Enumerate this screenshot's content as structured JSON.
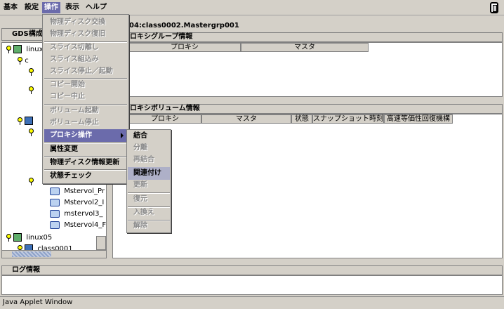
{
  "menubar": {
    "items": [
      "基本",
      "設定",
      "操作",
      "表示",
      "ヘルプ"
    ]
  },
  "left_panel": {
    "title": "GDS構成ツ",
    "tree": {
      "node1": "linux",
      "class_partial": "c",
      "volumes": [
        "Mstervol_Pr",
        "Mstervol2_I",
        "mstervol3_",
        "Mstervol4_F"
      ],
      "node2": "linux05",
      "class2": "class0001"
    }
  },
  "right_panel": {
    "title": "04:class0002.Mastergrp001",
    "group_section": {
      "heading": "ロキシグループ情報",
      "columns": [
        "プロキシ",
        "マスタ"
      ]
    },
    "volume_section": {
      "heading": "ロキシボリューム情報",
      "columns": [
        "プロキシ",
        "マスタ",
        "状態",
        "スナップショット時刻",
        "高速等価性回復機構"
      ]
    }
  },
  "dropdown": {
    "items": [
      {
        "label": "物理ディスク交換",
        "enabled": false
      },
      {
        "label": "物理ディスク復旧",
        "enabled": false
      },
      {
        "label": "スライス切離し",
        "enabled": false
      },
      {
        "label": "スライス組込み",
        "enabled": false
      },
      {
        "label": "スライス停止／起動",
        "enabled": false
      },
      {
        "label": "コピー開始",
        "enabled": false
      },
      {
        "label": "コピー中止",
        "enabled": false
      },
      {
        "label": "ボリューム起動",
        "enabled": false
      },
      {
        "label": "ボリューム停止",
        "enabled": false
      },
      {
        "label": "プロキシ操作",
        "enabled": true
      },
      {
        "label": "属性変更",
        "enabled": true
      },
      {
        "label": "物理ディスク情報更新",
        "enabled": true
      },
      {
        "label": "状態チェック",
        "enabled": true
      }
    ]
  },
  "submenu": {
    "items": [
      {
        "label": "結合",
        "enabled": true
      },
      {
        "label": "分離",
        "enabled": false
      },
      {
        "label": "再結合",
        "enabled": false
      },
      {
        "label": "関連付け",
        "enabled": true
      },
      {
        "label": "更新",
        "enabled": false
      },
      {
        "label": "復元",
        "enabled": false
      },
      {
        "label": "入換え",
        "enabled": false
      },
      {
        "label": "解除",
        "enabled": false
      }
    ]
  },
  "log": {
    "title": "ログ情報"
  },
  "status_bar": {
    "text": "Java Applet Window"
  },
  "colors": {
    "background": "#d4d0c8",
    "highlight": "#6b6bab",
    "submenu_highlight": "#aeb0c8"
  }
}
